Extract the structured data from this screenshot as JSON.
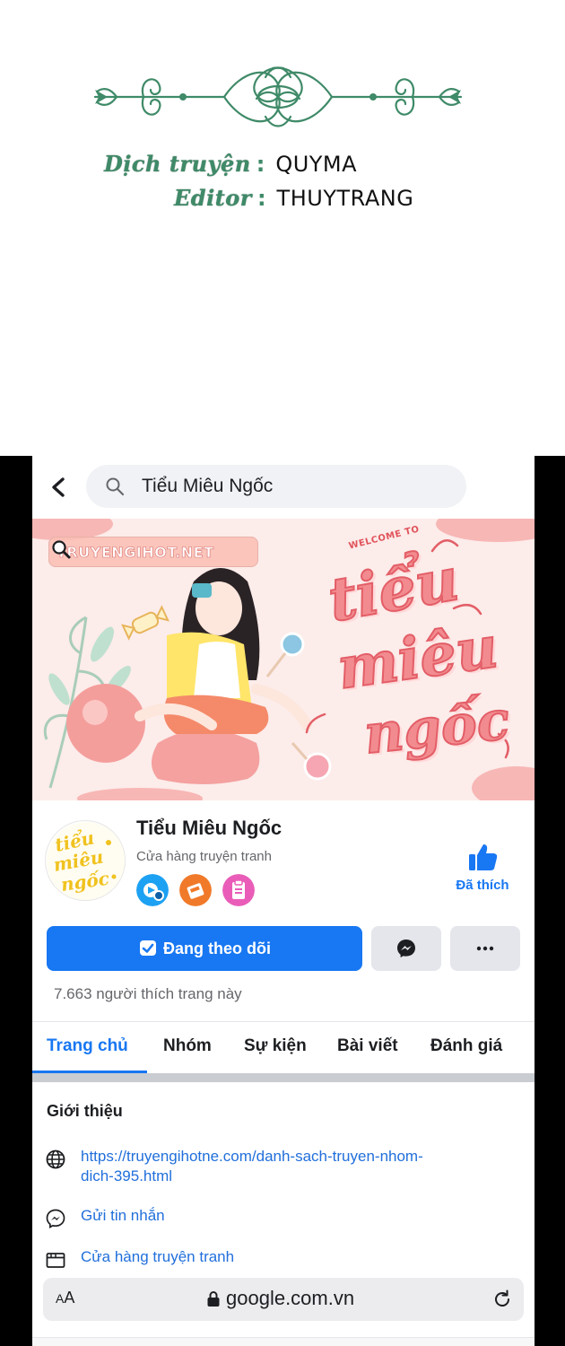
{
  "credits": {
    "translator_label": "Dịch truyện",
    "translator_name": "QUYMA",
    "editor_label": "Editor",
    "editor_name": "THUYTRANG",
    "separator": ":"
  },
  "search": {
    "back_icon": "chevron-left-icon",
    "search_icon": "search-icon",
    "query": "Tiểu Miêu Ngốc"
  },
  "cover": {
    "site_badge": "TRUYENGIHOT.NET",
    "welcome": "WELCOME TO",
    "script_line_1": "tiểu",
    "script_line_2": "miêu",
    "script_line_3": "ngốc"
  },
  "profile": {
    "name": "Tiểu Miêu Ngốc",
    "category": "Cửa hàng truyện tranh",
    "like_status": "Đã thích",
    "follow_button": "Đang theo dõi",
    "likes_count": "7.663 người thích trang này",
    "avatar_text": "tiểu miêu ngốc"
  },
  "tabs": [
    {
      "label": "Trang chủ",
      "active": true
    },
    {
      "label": "Nhóm",
      "active": false
    },
    {
      "label": "Sự kiện",
      "active": false
    },
    {
      "label": "Bài viết",
      "active": false
    },
    {
      "label": "Đánh giá",
      "active": false
    }
  ],
  "intro": {
    "title": "Giới thiệu",
    "website_line_1": "https://truyengihotne.com/danh-sach-truyen-nhom-",
    "website_line_2": "dich-395.html",
    "message": "Gửi tin nhắn",
    "store": "Cửa hàng truyện tranh"
  },
  "browser": {
    "text_size_big": "A",
    "text_size_small": "A",
    "url": "google.com.vn"
  },
  "colors": {
    "facebook_blue": "#1877f2",
    "link_blue": "#216fdb",
    "credit_green": "#3f8a68",
    "cover_pink": "#f28b8f"
  }
}
